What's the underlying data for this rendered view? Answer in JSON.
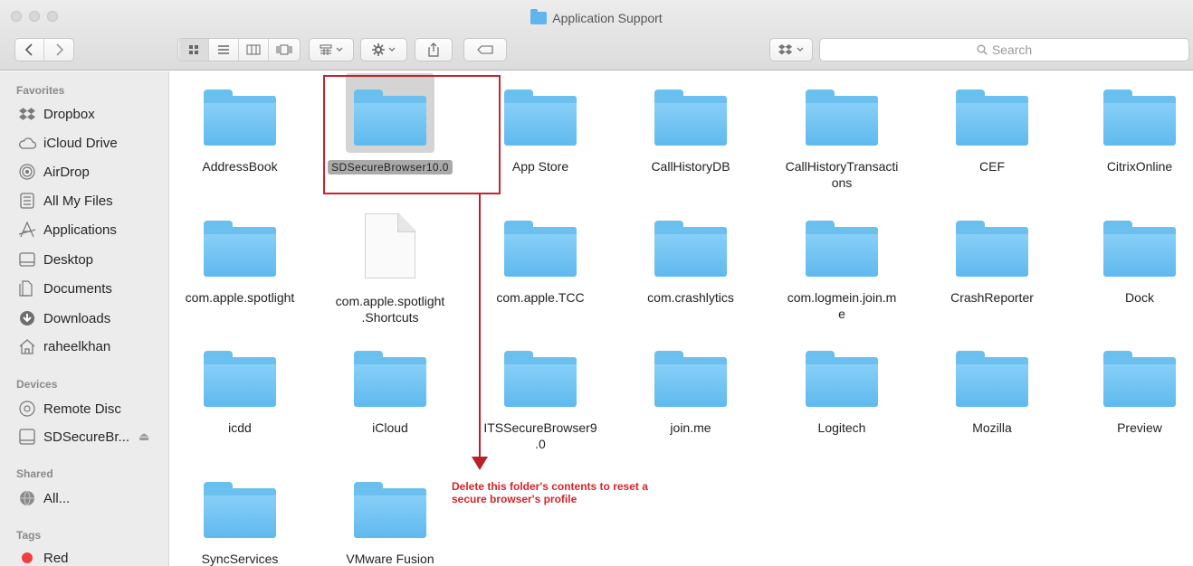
{
  "window": {
    "title": "Application Support"
  },
  "toolbar": {
    "back_icon": "chevron-left",
    "forward_icon": "chevron-right",
    "view_modes": [
      "icon-view",
      "list-view",
      "column-view",
      "cover-flow-view"
    ],
    "arrange_icon": "arrange-grid",
    "action_icon": "gear",
    "share_icon": "share",
    "tag_icon": "tag",
    "dropbox_icon": "dropbox",
    "search_placeholder": "Search"
  },
  "sidebar": {
    "favorites_heading": "Favorites",
    "favorites": [
      {
        "label": "Dropbox",
        "icon": "dropbox"
      },
      {
        "label": "iCloud Drive",
        "icon": "cloud"
      },
      {
        "label": "AirDrop",
        "icon": "airdrop"
      },
      {
        "label": "All My Files",
        "icon": "all-files"
      },
      {
        "label": "Applications",
        "icon": "applications"
      },
      {
        "label": "Desktop",
        "icon": "desktop"
      },
      {
        "label": "Documents",
        "icon": "documents"
      },
      {
        "label": "Downloads",
        "icon": "downloads"
      },
      {
        "label": "raheelkhan",
        "icon": "home"
      }
    ],
    "devices_heading": "Devices",
    "devices": [
      {
        "label": "Remote Disc",
        "icon": "disc"
      },
      {
        "label": "SDSecureBr...",
        "icon": "drive",
        "eject": "⏏"
      }
    ],
    "shared_heading": "Shared",
    "shared": [
      {
        "label": "All...",
        "icon": "network"
      }
    ],
    "tags_heading": "Tags",
    "tags": [
      {
        "label": "Red",
        "color": "#ef4040"
      }
    ]
  },
  "files": [
    {
      "name": "AddressBook",
      "type": "folder"
    },
    {
      "name": "SDSecureBrowser10.0",
      "type": "folder",
      "selected": true
    },
    {
      "name": "App Store",
      "type": "folder"
    },
    {
      "name": "CallHistoryDB",
      "type": "folder"
    },
    {
      "name": "CallHistoryTransactions",
      "type": "folder",
      "display": "CallHistoryTransacti\nons"
    },
    {
      "name": "CEF",
      "type": "folder"
    },
    {
      "name": "CitrixOnline",
      "type": "folder"
    },
    {
      "name": "com.apple.spotlight",
      "type": "folder"
    },
    {
      "name": "com.apple.spotlight.Shortcuts",
      "type": "document",
      "display": "com.apple.spotlight\n.Shortcuts"
    },
    {
      "name": "com.apple.TCC",
      "type": "folder"
    },
    {
      "name": "com.crashlytics",
      "type": "folder"
    },
    {
      "name": "com.logmein.join.me",
      "type": "folder",
      "display": "com.logmein.join.m\ne"
    },
    {
      "name": "CrashReporter",
      "type": "folder"
    },
    {
      "name": "Dock",
      "type": "folder"
    },
    {
      "name": "icdd",
      "type": "folder"
    },
    {
      "name": "iCloud",
      "type": "folder"
    },
    {
      "name": "ITSSecureBrowser9.0",
      "type": "folder",
      "display": "ITSSecureBrowser9\n.0"
    },
    {
      "name": "join.me",
      "type": "folder"
    },
    {
      "name": "Logitech",
      "type": "folder"
    },
    {
      "name": "Mozilla",
      "type": "folder"
    },
    {
      "name": "Preview",
      "type": "folder"
    },
    {
      "name": "SyncServices",
      "type": "folder"
    },
    {
      "name": "VMware Fusion",
      "type": "folder"
    }
  ],
  "annotation": {
    "note": "Delete this folder's contents to reset a secure browser's profile",
    "color": "#d8232a"
  }
}
